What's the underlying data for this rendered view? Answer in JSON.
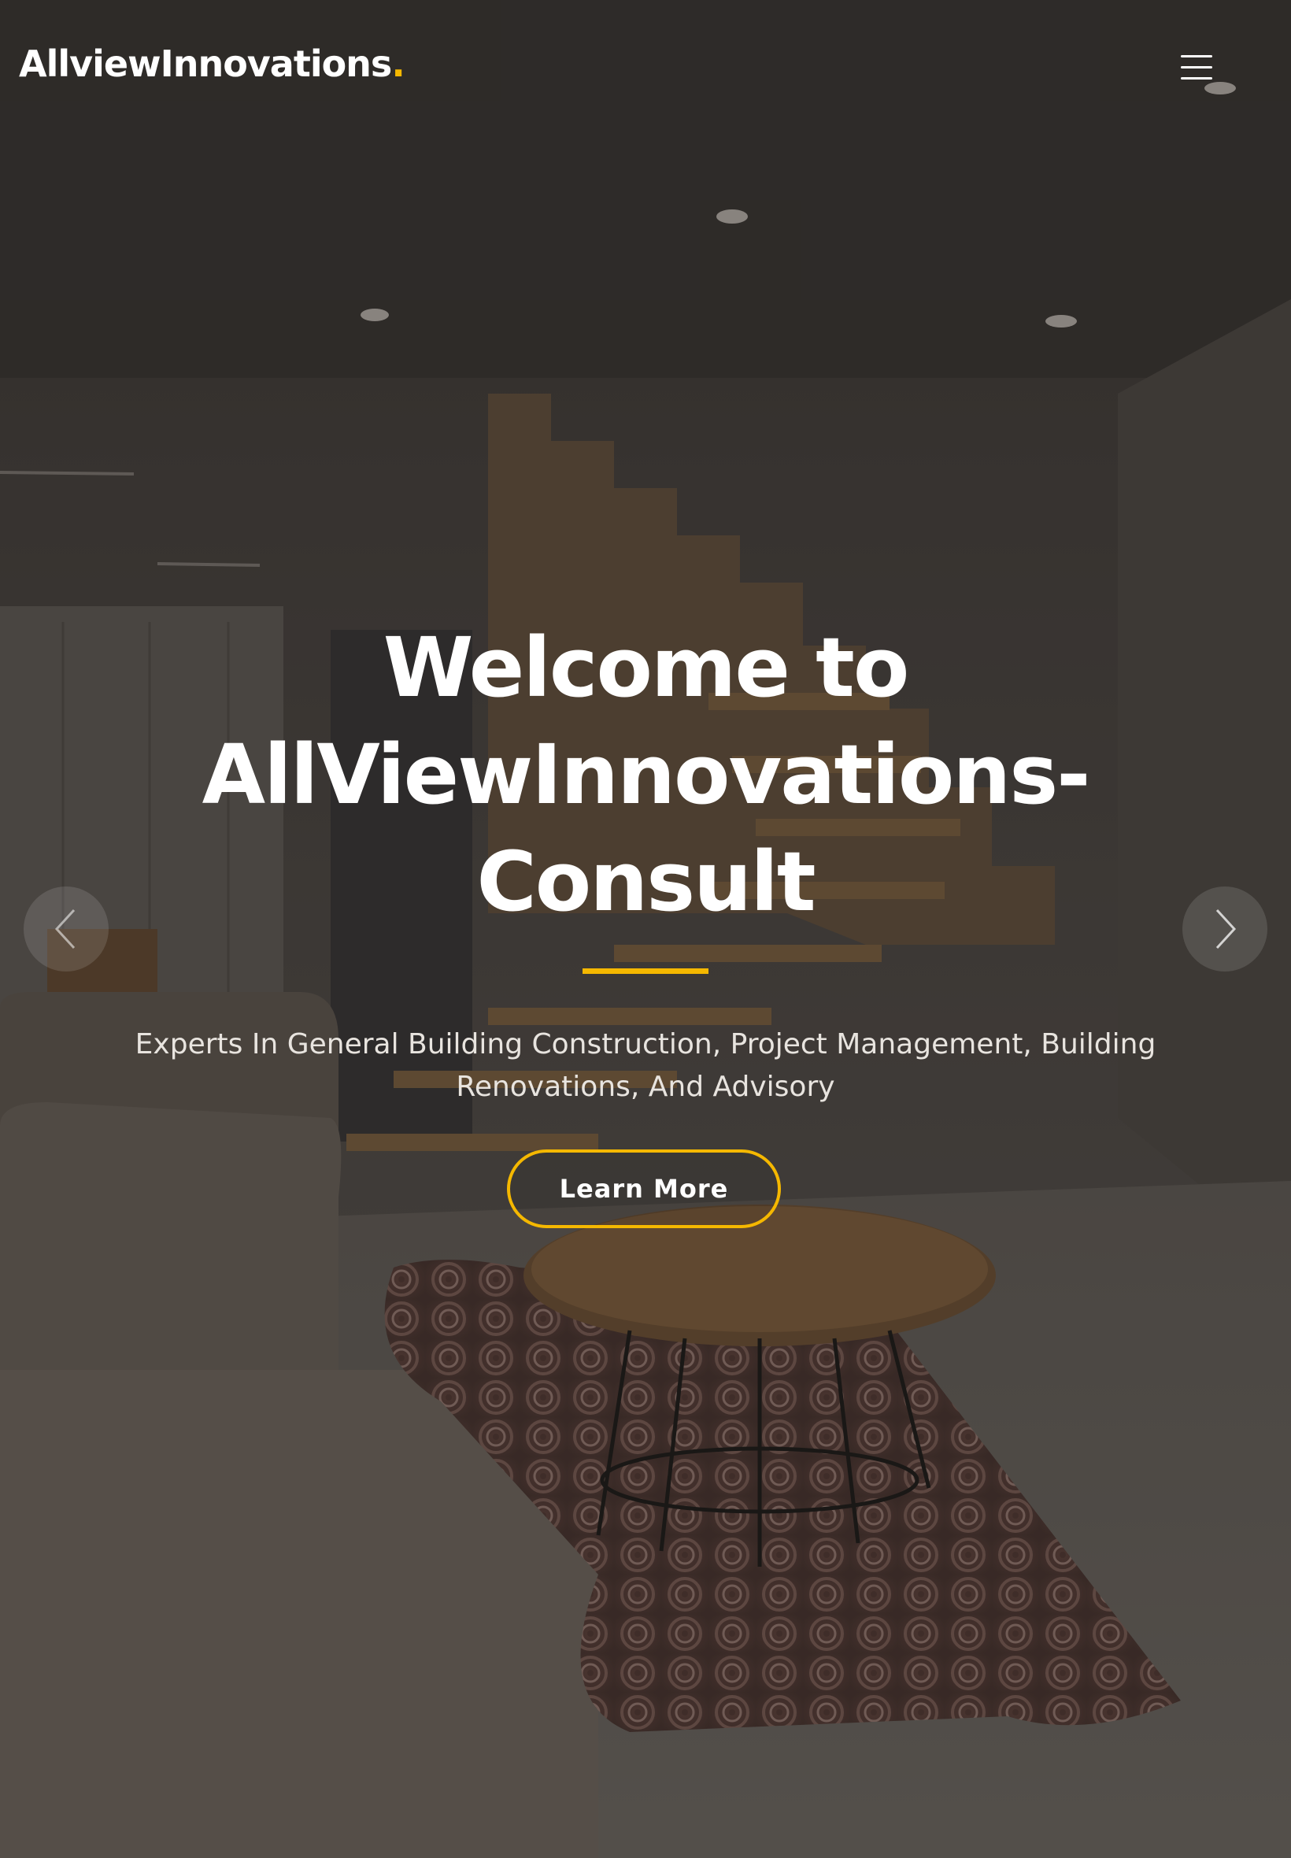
{
  "header": {
    "logo_text": "AllviewInnovations",
    "logo_dot": ".",
    "menu_icon": "hamburger-menu-icon"
  },
  "hero": {
    "title": "Welcome to AllViewInnovations-Consult",
    "subtitle": "Experts In General Building Construction, Project Management, Building Renovations, And Advisory",
    "cta_label": "Learn More",
    "background_image": "living-room-with-floating-staircase-photo"
  },
  "carousel": {
    "prev_icon": "chevron-left-icon",
    "next_icon": "chevron-right-icon"
  },
  "colors": {
    "accent": "#f5b800",
    "text": "#ffffff",
    "overlay": "#141211"
  }
}
